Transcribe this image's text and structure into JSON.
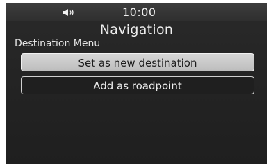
{
  "status_bar": {
    "volume_icon": "volume-icon",
    "time": "10:00"
  },
  "header": {
    "title": "Navigation",
    "subtitle": "Destination Menu"
  },
  "menu": {
    "items": [
      {
        "label": "Set as new destination",
        "selected": true
      },
      {
        "label": "Add as roadpoint",
        "selected": false
      }
    ]
  },
  "colors": {
    "background": "#242424",
    "selected_item": "#c8c8c8",
    "text": "#e8e8e8"
  }
}
